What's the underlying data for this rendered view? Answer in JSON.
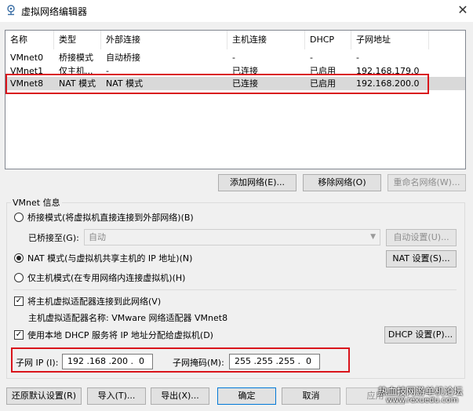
{
  "window": {
    "title": "虚拟网络编辑器"
  },
  "network_table": {
    "columns": [
      "名称",
      "类型",
      "外部连接",
      "主机连接",
      "DHCP",
      "子网地址"
    ],
    "rows": [
      [
        "VMnet0",
        "桥接模式",
        "自动桥接",
        "-",
        "-",
        "-"
      ],
      [
        "VMnet1",
        "仅主机...",
        "-",
        "已连接",
        "已启用",
        "192.168.179.0"
      ],
      [
        "VMnet8",
        "NAT 模式",
        "NAT 模式",
        "已连接",
        "已启用",
        "192.168.200.0"
      ]
    ],
    "selected_row": 2
  },
  "table_buttons": {
    "add": "添加网络(E)...",
    "remove": "移除网络(O)",
    "rename": "重命名网络(W)..."
  },
  "vmnet_info": {
    "label": "VMnet 信息",
    "bridge_mode": "桥接模式(将虚拟机直接连接到外部网络)(B)",
    "bridged_to_label": "已桥接至(G):",
    "bridged_to_value": "自动",
    "auto_settings": "自动设置(U)...",
    "nat_mode": "NAT 模式(与虚拟机共享主机的 IP 地址)(N)",
    "nat_settings": "NAT 设置(S)...",
    "host_only": "仅主机模式(在专用网络内连接虚拟机)(H)",
    "selected_mode": "nat",
    "connect_adapter": "将主机虚拟适配器连接到此网络(V)",
    "connect_adapter_checked": true,
    "adapter_name": "主机虚拟适配器名称: VMware 网络适配器 VMnet8",
    "use_dhcp": "使用本地 DHCP 服务将 IP 地址分配给虚拟机(D)",
    "use_dhcp_checked": true,
    "dhcp_settings": "DHCP 设置(P)...",
    "subnet_ip_label": "子网 IP (I):",
    "subnet_ip": "192 .168 .200 .  0",
    "subnet_mask_label": "子网掩码(M):",
    "subnet_mask": "255 .255 .255 .  0"
  },
  "footer_buttons": {
    "restore": "还原默认设置(R)",
    "import": "导入(T)...",
    "export": "导出(X)...",
    "ok": "确定",
    "cancel": "取消",
    "apply": "应用"
  },
  "watermark": {
    "line1": "热血技网游单机论坛",
    "line2": "www.rexuedu.com"
  },
  "colors": {
    "highlight": "#d9141b",
    "selected_row": "#d9d9d9"
  }
}
